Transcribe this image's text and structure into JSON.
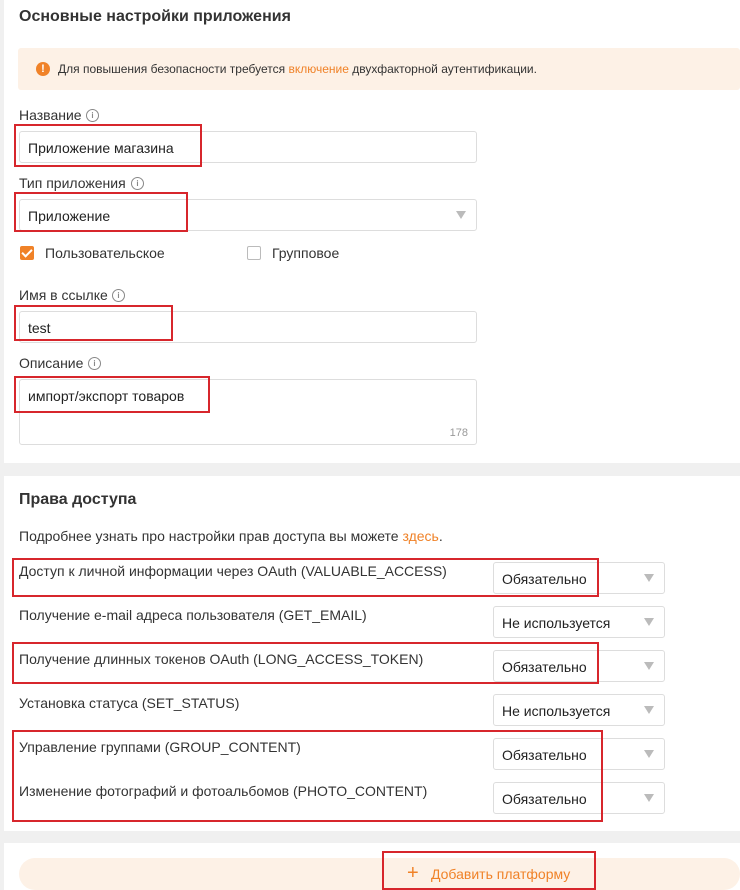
{
  "settings": {
    "title": "Основные настройки приложения",
    "alert": {
      "text_before": "Для повышения безопасности требуется",
      "link": "включение",
      "text_after": "двухфакторной аутентификации."
    },
    "name": {
      "label": "Название",
      "value": "Приложение магазина"
    },
    "type": {
      "label": "Тип приложения",
      "value": "Приложение"
    },
    "checkboxes": [
      {
        "label": "Пользовательское",
        "checked": true
      },
      {
        "label": "Групповое",
        "checked": false
      }
    ],
    "link_name": {
      "label": "Имя в ссылке",
      "value": "test"
    },
    "description": {
      "label": "Описание",
      "value": "импорт/экспорт товаров",
      "counter": "178"
    }
  },
  "access": {
    "title": "Права доступа",
    "intro_text": "Подробнее узнать про настройки прав доступа вы можете",
    "intro_link": "здесь",
    "intro_end": ".",
    "rows": [
      {
        "label": "Доступ к личной информации через OAuth (VALUABLE_ACCESS)",
        "value": "Обязательно"
      },
      {
        "label": "Получение e-mail адреса пользователя (GET_EMAIL)",
        "value": "Не используется"
      },
      {
        "label": "Получение длинных токенов OAuth (LONG_ACCESS_TOKEN)",
        "value": "Обязательно"
      },
      {
        "label": "Установка статуса (SET_STATUS)",
        "value": "Не используется"
      },
      {
        "label": "Управление группами (GROUP_CONTENT)",
        "value": "Обязательно"
      },
      {
        "label": "Изменение фотографий и фотоальбомов (PHOTO_CONTENT)",
        "value": "Обязательно"
      }
    ]
  },
  "platform": {
    "button_label": "Добавить платформу",
    "plus": "+"
  },
  "icons": {
    "alert": "exclamation-circle-icon",
    "info": "info-circle-icon",
    "dropdown": "dropdown-triangle-icon"
  },
  "colors": {
    "accent": "#f08228",
    "highlight": "#d7262c",
    "alert_bg": "#fdf1e6"
  }
}
